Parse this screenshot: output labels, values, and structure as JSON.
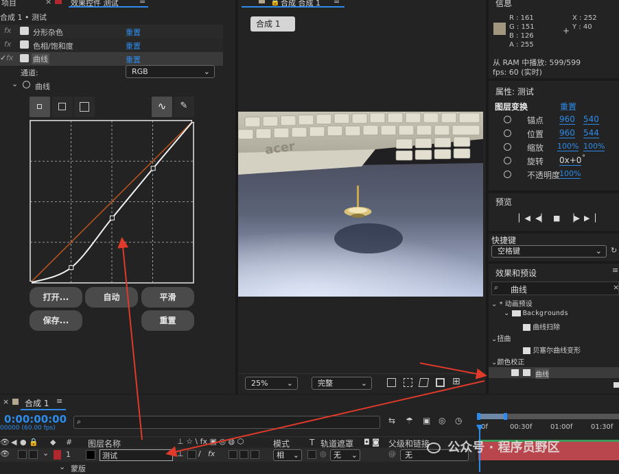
{
  "effect_panel": {
    "tab_project": "项目",
    "tab_effect": "效果控件 测试",
    "breadcrumb": "合成 1 • 测试",
    "effects": [
      {
        "name": "分形杂色",
        "reset": "重置"
      },
      {
        "name": "色相/饱和度",
        "reset": "重置"
      },
      {
        "name": "曲线",
        "reset": "重置"
      }
    ],
    "channel_label": "通道:",
    "channel_value": "RGB",
    "curves_label": "曲线",
    "buttons": {
      "open": "打开...",
      "auto": "自动",
      "smooth": "平滑",
      "save": "保存...",
      "reset": "重置"
    }
  },
  "comp_panel": {
    "title": "合成 合成 1",
    "tab": "合成 1",
    "zoom": "25%",
    "quality": "完整"
  },
  "info_panel": {
    "title": "信息",
    "r": "R : 161",
    "g": "G : 151",
    "b": "B : 126",
    "a": "A : 255",
    "x": "X : 252",
    "y": "Y : 40",
    "swatch_color": "#a1977e",
    "ram_line": "从 RAM 中播放: 599/599",
    "fps_line": "fps: 60 (实时)"
  },
  "properties": {
    "title": "属性: 测试",
    "section": "图层变换",
    "reset": "重置",
    "rows": [
      {
        "name": "锚点",
        "v1": "960",
        "v2": "540"
      },
      {
        "name": "位置",
        "v1": "960",
        "v2": "544"
      },
      {
        "name": "缩放",
        "v1": "100%",
        "v2": "100%"
      },
      {
        "name": "旋转",
        "v1": "0x+0",
        "v2": "°"
      },
      {
        "name": "不透明度",
        "v1": "100%",
        "v2": ""
      }
    ]
  },
  "preview": {
    "title": "预览"
  },
  "shortcut": {
    "title": "快捷键",
    "value": "空格键"
  },
  "effects_presets": {
    "title": "效果和预设",
    "search": "曲线",
    "tree": [
      {
        "label": "* 动画预设"
      },
      {
        "label": "Backgrounds"
      },
      {
        "label": "曲线扫除"
      },
      {
        "label": "扭曲"
      },
      {
        "label": "贝塞尔曲线变形"
      },
      {
        "label": "颜色校正"
      },
      {
        "label": "曲线"
      }
    ]
  },
  "timeline": {
    "comp_tab": "合成 1",
    "timecode": "0:00:00:00",
    "fps_sub": "00000 (60.00 fps)",
    "headers": {
      "num": "#",
      "layer_name": "图层名称",
      "mode": "模式",
      "t": "T",
      "track_matte": "轨道遮罩",
      "parent": "父级和链接"
    },
    "layer": {
      "index": "1",
      "name": "测试",
      "mode": "相",
      "matte": "无",
      "parent": "无"
    },
    "sub": "蒙版",
    "ruler": [
      "0f",
      "00:30f",
      "01:00f",
      "01:30f"
    ]
  },
  "watermark": "公众号 · 程序员野区",
  "chart_data": {
    "type": "line",
    "series": [
      {
        "values": [
          [
            0,
            0
          ],
          [
            64,
            24
          ],
          [
            128,
            102
          ],
          [
            192,
            180
          ],
          [
            255,
            255
          ]
        ]
      },
      {
        "values": [
          [
            0,
            0
          ],
          [
            255,
            255
          ]
        ]
      }
    ],
    "xlim": [
      0,
      255
    ],
    "ylim": [
      0,
      255
    ]
  }
}
